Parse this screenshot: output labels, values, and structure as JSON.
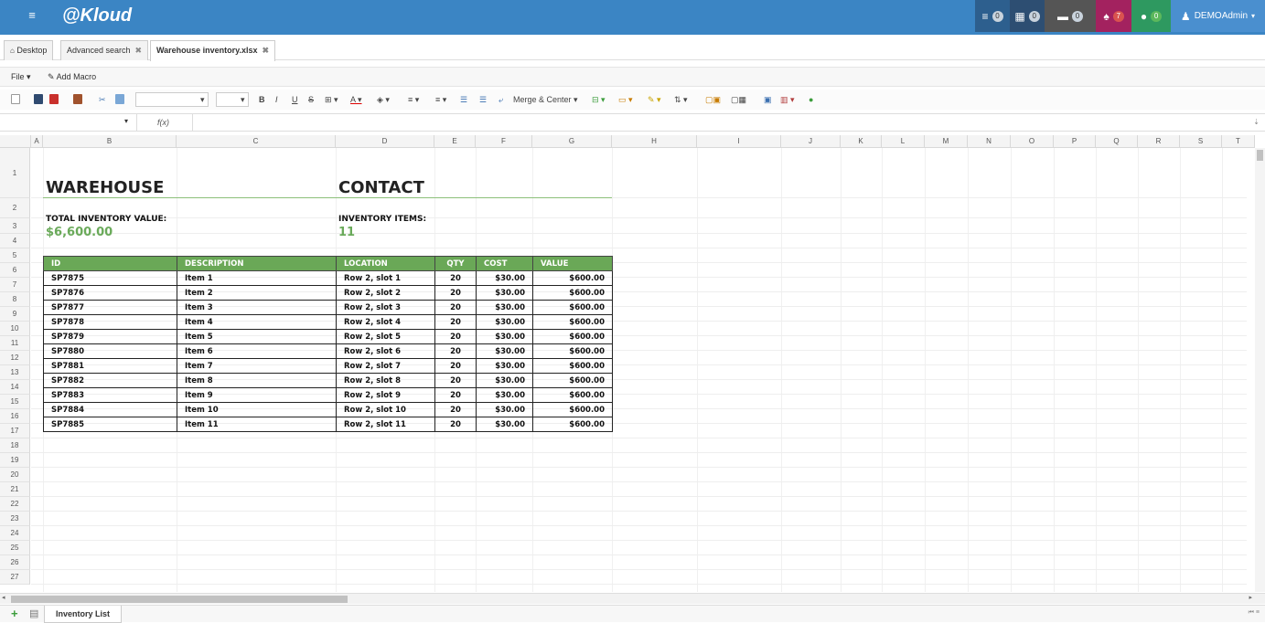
{
  "app": {
    "logo": "@Kloud",
    "menu_icon": "hamburger-icon"
  },
  "nav": [
    {
      "icon": "list-icon",
      "glyph": "≡",
      "badge": "0",
      "bg": "#2d5f8e"
    },
    {
      "icon": "calendar-icon",
      "glyph": "▦",
      "badge": "0",
      "bg": "#2d4e72"
    },
    {
      "icon": "card-icon",
      "glyph": "▬",
      "badge": "0",
      "bg": "#555555"
    },
    {
      "icon": "bell-icon",
      "glyph": "♠",
      "badge": "7",
      "bg": "#a3225f"
    },
    {
      "icon": "chat-icon",
      "glyph": "●",
      "badge": "0",
      "bg": "#2e9960"
    },
    {
      "icon": "user-icon",
      "glyph": "♟",
      "badge": "",
      "bg": "#4a8fcf",
      "label": "DEMOAdmin"
    }
  ],
  "tabs": [
    {
      "label": "Desktop",
      "icon": "home-icon",
      "closable": false
    },
    {
      "label": "Advanced search",
      "closable": true
    },
    {
      "label": "Warehouse inventory.xlsx",
      "closable": true,
      "active": true
    }
  ],
  "menubar": {
    "file": "File",
    "add_macro": "Add Macro"
  },
  "toolbar": {
    "merge_center": "Merge & Center"
  },
  "formula": {
    "fx": "f(x)",
    "cell_ref": "",
    "value": ""
  },
  "columns": [
    "A",
    "B",
    "C",
    "D",
    "E",
    "F",
    "G",
    "H",
    "I",
    "J",
    "K",
    "L",
    "M",
    "N",
    "O",
    "P",
    "Q",
    "R",
    "S",
    "T"
  ],
  "rows": [
    "1",
    "2",
    "3",
    "4",
    "5",
    "6",
    "7",
    "8",
    "9",
    "10",
    "11",
    "12",
    "13",
    "14",
    "15",
    "16",
    "17",
    "18",
    "19",
    "20",
    "21",
    "22",
    "23",
    "24",
    "25",
    "26",
    "27"
  ],
  "sheet": {
    "warehouse_title": "WAREHOUSE",
    "contact_title": "CONTACT",
    "total_label": "TOTAL INVENTORY VALUE:",
    "total_value": "$6,600.00",
    "items_label": "INVENTORY ITEMS:",
    "items_value": "11",
    "table_headers": [
      "ID",
      "DESCRIPTION",
      "LOCATION",
      "QTY",
      "COST",
      "VALUE"
    ],
    "table_rows": [
      [
        "SP7875",
        "Item 1",
        "Row 2, slot 1",
        "20",
        "$30.00",
        "$600.00"
      ],
      [
        "SP7876",
        "Item 2",
        "Row 2, slot 2",
        "20",
        "$30.00",
        "$600.00"
      ],
      [
        "SP7877",
        "Item 3",
        "Row 2, slot 3",
        "20",
        "$30.00",
        "$600.00"
      ],
      [
        "SP7878",
        "Item 4",
        "Row 2, slot 4",
        "20",
        "$30.00",
        "$600.00"
      ],
      [
        "SP7879",
        "Item 5",
        "Row 2, slot 5",
        "20",
        "$30.00",
        "$600.00"
      ],
      [
        "SP7880",
        "Item 6",
        "Row 2, slot 6",
        "20",
        "$30.00",
        "$600.00"
      ],
      [
        "SP7881",
        "Item 7",
        "Row 2, slot 7",
        "20",
        "$30.00",
        "$600.00"
      ],
      [
        "SP7882",
        "Item 8",
        "Row 2, slot 8",
        "20",
        "$30.00",
        "$600.00"
      ],
      [
        "SP7883",
        "Item 9",
        "Row 2, slot 9",
        "20",
        "$30.00",
        "$600.00"
      ],
      [
        "SP7884",
        "Item 10",
        "Row 2, slot 10",
        "20",
        "$30.00",
        "$600.00"
      ],
      [
        "SP7885",
        "Item 11",
        "Row 2, slot 11",
        "20",
        "$30.00",
        "$600.00"
      ]
    ]
  },
  "sheet_tab": "Inventory List",
  "colors": {
    "header_bg": "#3b85c4",
    "table_header": "#6aa857",
    "value_green": "#6aaa5a"
  }
}
